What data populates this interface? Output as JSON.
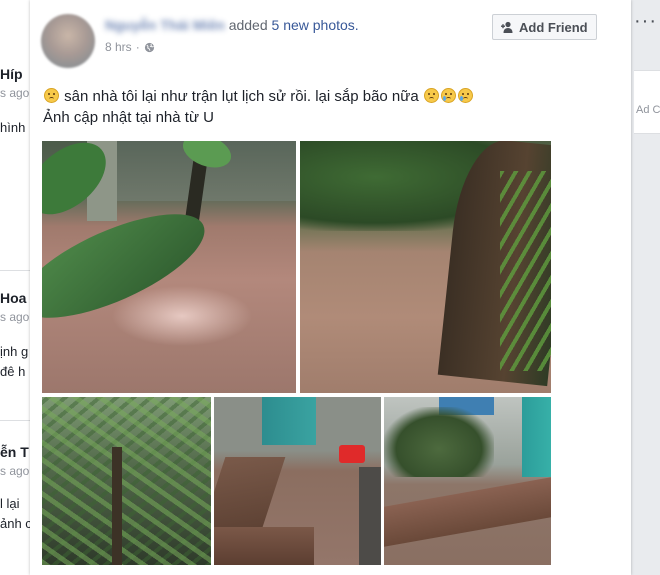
{
  "background_feed": {
    "fragments": [
      {
        "text": "Híp",
        "style": "bold"
      },
      {
        "text": "s ago",
        "style": "grey"
      },
      {
        "text": "hình",
        "style": "plain"
      },
      {
        "text": "Hoa",
        "style": "bold"
      },
      {
        "text": "s ago",
        "style": "grey"
      },
      {
        "text": "ịnh g",
        "style": "plain"
      },
      {
        "text": "đê h",
        "style": "plain"
      },
      {
        "text": "ễn T",
        "style": "bold"
      },
      {
        "text": "s ago",
        "style": "grey"
      },
      {
        "text": "l lại",
        "style": "plain"
      },
      {
        "text": "ảnh c",
        "style": "plain"
      }
    ],
    "right_menu": "···",
    "right_ad": "Ad C"
  },
  "post": {
    "poster_name": "Nguyễn Thái Miên",
    "action_text": "added",
    "photos_link": "5 new photos.",
    "time": "8 hrs",
    "separator": "·",
    "privacy_icon": "globe-icon",
    "add_friend_label": "Add Friend",
    "add_friend_icon": "add-friend-icon",
    "text_line1": "sân nhà tôi lại như trận lụt lịch sử rồi. lại sắp bão nữa",
    "text_line2": "Ảnh cập nhật tại nhà từ U",
    "emojis": [
      "sad-face-emoji",
      "sad-face-emoji",
      "crying-face-emoji",
      "crying-face-emoji"
    ]
  },
  "photos": [
    {
      "name": "photo-flooded-yard-1",
      "description_icon": "photo"
    },
    {
      "name": "photo-flooded-yard-2",
      "description_icon": "photo"
    },
    {
      "name": "photo-garden-trees",
      "description_icon": "photo"
    },
    {
      "name": "photo-flooded-walkway",
      "description_icon": "photo"
    },
    {
      "name": "photo-flooded-courtyard",
      "description_icon": "photo"
    }
  ],
  "colors": {
    "link": "#385898",
    "text": "#1d2129",
    "muted": "#90949c",
    "page_bg": "#e9ebee"
  }
}
